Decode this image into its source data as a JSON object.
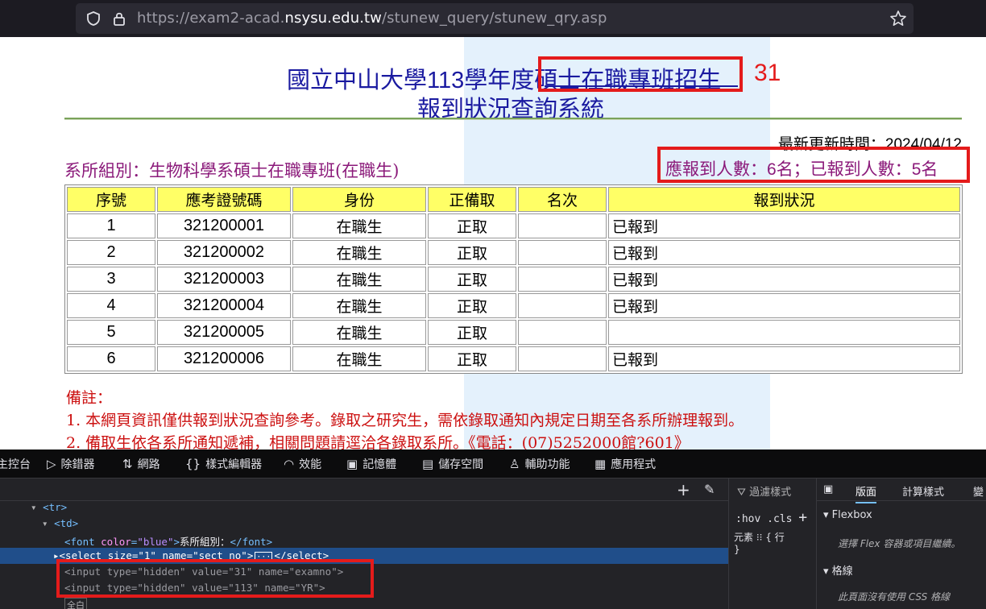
{
  "browser": {
    "url_prefix": "https://exam2-acad.",
    "url_domain": "nsysu.edu.tw",
    "url_path": "/stunew_query/stunew_qry.asp"
  },
  "page": {
    "title_prefix": "國立中山大學",
    "title_year": "113",
    "title_mid": "學年度",
    "title_program": "碩士在職專班招生",
    "subtitle": "報到狀況查詢系統",
    "annotation_number": "31",
    "update_label": "最新更新時間：",
    "update_value": "2024/04/12",
    "dept_text": "系所組別：生物科學系碩士在職專班(在職生)",
    "counts": {
      "expected_label": "應報到人數：",
      "expected_value": "6",
      "unit1": "名；已報到人數：",
      "reported_value": "5",
      "unit2": "名"
    }
  },
  "table": {
    "headers": [
      "序號",
      "應考證號碼",
      "身份",
      "正備取",
      "名次",
      "報到狀況"
    ],
    "rows": [
      {
        "no": "1",
        "id": "321200001",
        "identity": "在職生",
        "type": "正取",
        "rank": "",
        "status": "已報到"
      },
      {
        "no": "2",
        "id": "321200002",
        "identity": "在職生",
        "type": "正取",
        "rank": "",
        "status": "已報到"
      },
      {
        "no": "3",
        "id": "321200003",
        "identity": "在職生",
        "type": "正取",
        "rank": "",
        "status": "已報到"
      },
      {
        "no": "4",
        "id": "321200004",
        "identity": "在職生",
        "type": "正取",
        "rank": "",
        "status": "已報到"
      },
      {
        "no": "5",
        "id": "321200005",
        "identity": "在職生",
        "type": "正取",
        "rank": "",
        "status": ""
      },
      {
        "no": "6",
        "id": "321200006",
        "identity": "在職生",
        "type": "正取",
        "rank": "",
        "status": "已報到"
      }
    ]
  },
  "notes": {
    "heading": "備註：",
    "line1": "1. 本網頁資訊僅供報到狀況查詢參考。錄取之研究生，需依錄取通知內規定日期至各系所辦理報到。",
    "line2": "2. 備取生依各系所通知遞補，相關問題請逕洽各錄取系所。《電話：(07)5252000館?601》"
  },
  "devtools": {
    "tabs": [
      "主控台",
      "除錯器",
      "網路",
      "樣式編輯器",
      "效能",
      "記憶體",
      "儲存空間",
      "輔助功能",
      "應用程式"
    ],
    "tab_icons": [
      "console-icon",
      "debugger-icon",
      "network-icon",
      "style-editor-icon",
      "performance-icon",
      "memory-icon",
      "storage-icon",
      "accessibility-icon",
      "application-icon"
    ],
    "code": {
      "tr": "<tr>",
      "td": "<td>",
      "font_open": "<font ",
      "font_attr": "color",
      "font_val": "\"blue\"",
      "font_text": "系所組別：",
      "font_close": "</font>",
      "select_line": "<select size=\"1\" name=\"sect_no\">",
      "select_close": "</select>",
      "input1_type": "\"hidden\"",
      "input1_value": "\"31\"",
      "input1_name": "\"examno\"",
      "input2_type": "\"hidden\"",
      "input2_value": "\"113\"",
      "input2_name": "\"YR\"",
      "last_line": "全白"
    },
    "filter_label": "過濾樣式",
    "hov_label": ":hov",
    "cls_label": ".cls",
    "element_label": "元素 ⁝⁝ {  行",
    "element_close": "}",
    "right_tabs": [
      "版面",
      "計算樣式",
      "變"
    ],
    "flexbox_label": "Flexbox",
    "flexbox_hint": "選擇 Flex 容器或項目繼續。",
    "grid_label": "格線",
    "grid_hint": "此頁面沒有使用 CSS 格線"
  }
}
